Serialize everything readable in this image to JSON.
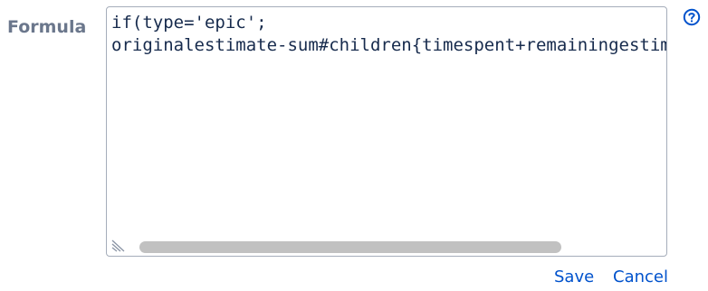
{
  "field": {
    "label": "Formula",
    "value": "if(type='epic';\noriginalestimate-sum#children{timespent+remainingestimate})",
    "scroll_position": 0.0
  },
  "actions": {
    "save_label": "Save",
    "cancel_label": "Cancel"
  },
  "icons": {
    "help": "question-circle-icon",
    "resize": "resize-grip-icon"
  },
  "colors": {
    "label": "#6b778c",
    "link": "#0052cc",
    "border": "#a5adba",
    "scroll_thumb": "#c1c1c1"
  }
}
